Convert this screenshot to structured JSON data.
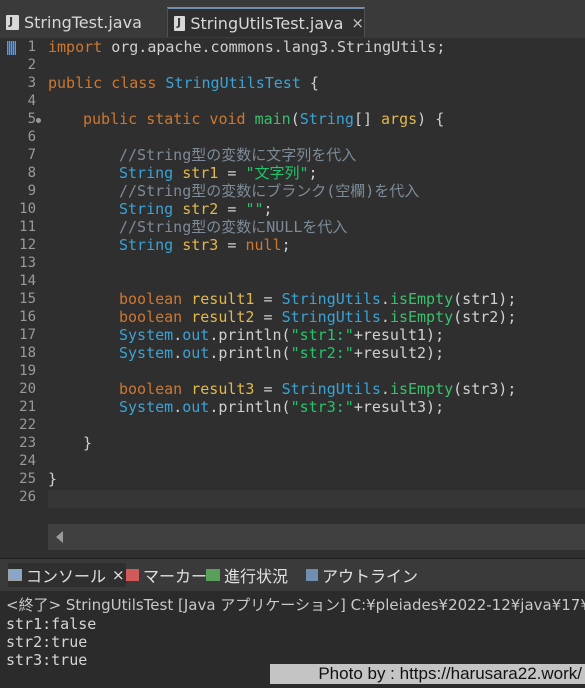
{
  "editor_tabs": [
    {
      "label": "StringTest.java",
      "active": false
    },
    {
      "label": "StringUtilsTest.java",
      "active": true,
      "close": "×"
    }
  ],
  "line_numbers": [
    "1",
    "2",
    "3",
    "4",
    "5",
    "6",
    "7",
    "8",
    "9",
    "10",
    "11",
    "12",
    "13",
    "14",
    "15",
    "16",
    "17",
    "18",
    "19",
    "20",
    "21",
    "22",
    "23",
    "24",
    "25",
    "26"
  ],
  "code": {
    "l1_kw": "import",
    "l1_rest": " org.apache.commons.lang3.StringUtils;",
    "l3_kw": "public class",
    "l3_cls": "StringUtilsTest",
    "l3_rest": " {",
    "l5_kw": "public static void",
    "l5_mth": "main",
    "l5_p1": "(",
    "l5_ty": "String",
    "l5_p2": "[] ",
    "l5_var": "args",
    "l5_p3": ") {",
    "l7_cm": "//String型の変数に文字列を代入",
    "l8_ty": "String",
    "l8_var": "str1",
    "l8_eq": " = ",
    "l8_str": "\"文字列\"",
    "l8_end": ";",
    "l9_cm": "//String型の変数にブランク(空欄)を代入",
    "l10_ty": "String",
    "l10_var": "str2",
    "l10_eq": " = ",
    "l10_str": "\"\"",
    "l10_end": ";",
    "l11_cm": "//String型の変数にNULLを代入",
    "l12_ty": "String",
    "l12_var": "str3",
    "l12_eq": " = ",
    "l12_kw": "null",
    "l12_end": ";",
    "l15_kw": "boolean",
    "l15_var": "result1",
    "l15_eq": " = ",
    "l15_cls": "StringUtils",
    "l15_dot": ".",
    "l15_mth": "isEmpty",
    "l15_end": "(str1);",
    "l16_kw": "boolean",
    "l16_var": "result2",
    "l16_eq": " = ",
    "l16_cls": "StringUtils",
    "l16_dot": ".",
    "l16_mth": "isEmpty",
    "l16_end": "(str2);",
    "l17_cls": "System",
    "l17_dot": ".",
    "l17_out": "out",
    "l17_pr": ".println(",
    "l17_str": "\"str1:\"",
    "l17_end": "+result1);",
    "l18_cls": "System",
    "l18_dot": ".",
    "l18_out": "out",
    "l18_pr": ".println(",
    "l18_str": "\"str2:\"",
    "l18_end": "+result2);",
    "l20_kw": "boolean",
    "l20_var": "result3",
    "l20_eq": " = ",
    "l20_cls": "StringUtils",
    "l20_dot": ".",
    "l20_mth": "isEmpty",
    "l20_end": "(str3);",
    "l21_cls": "System",
    "l21_dot": ".",
    "l21_out": "out",
    "l21_pr": ".println(",
    "l21_str": "\"str3:\"",
    "l21_end": "+result3);",
    "l23": "}",
    "l25": "}"
  },
  "console_tabs": [
    {
      "label": "コンソール",
      "close": "×",
      "icon": "console-icon"
    },
    {
      "label": "マーカー",
      "icon": "marker-icon"
    },
    {
      "label": "進行状況",
      "icon": "progress-icon"
    },
    {
      "label": "アウトライン",
      "icon": "outline-icon"
    }
  ],
  "console": {
    "header": "<終了> StringUtilsTest [Java アプリケーション] C:¥pleiades¥2022-12¥java¥17¥",
    "output": [
      "str1:false",
      "str2:true",
      "str3:true"
    ]
  },
  "watermark": "Photo by : https://harusara22.work/",
  "colors": {
    "keyword": "#cc7832",
    "type": "#3aa3d6",
    "string": "#1fc76a",
    "variable": "#e3b84a",
    "method": "#39c06b",
    "comment": "#7d8b99",
    "background": "#2f2f2f"
  }
}
